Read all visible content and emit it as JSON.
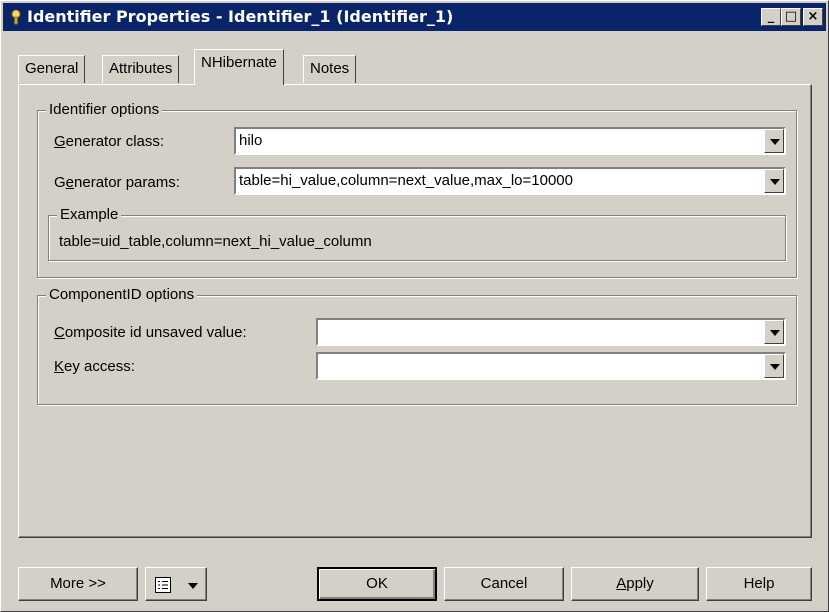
{
  "window": {
    "title": "Identifier Properties - Identifier_1 (Identifier_1)",
    "minimize_label": "_",
    "maximize_label": "□",
    "close_label": "×"
  },
  "tabs": [
    {
      "label": "General"
    },
    {
      "label": "Attributes"
    },
    {
      "label": "NHibernate",
      "active": true
    },
    {
      "label": "Notes"
    }
  ],
  "identifier_options": {
    "legend": "Identifier options",
    "generator_class": {
      "label_access": "G",
      "label_rest": "enerator class:",
      "value": "hilo"
    },
    "generator_params": {
      "label_pre": "G",
      "label_access": "e",
      "label_rest": "nerator params:",
      "value": "table=hi_value,column=next_value,max_lo=10000"
    },
    "example": {
      "legend": "Example",
      "text": "table=uid_table,column=next_hi_value_column"
    }
  },
  "component_options": {
    "legend": "ComponentID options",
    "composite_unsaved": {
      "label_access": "C",
      "label_rest": "omposite id unsaved value:",
      "value": ""
    },
    "key_access": {
      "label_access": "K",
      "label_rest": "ey access:",
      "value": ""
    }
  },
  "buttons": {
    "more": "More >>",
    "ok": "OK",
    "cancel": "Cancel",
    "apply_access": "A",
    "apply_rest": "pply",
    "help": "Help"
  },
  "colors": {
    "titlebar": "#0a246a",
    "face": "#d4d0c8"
  }
}
